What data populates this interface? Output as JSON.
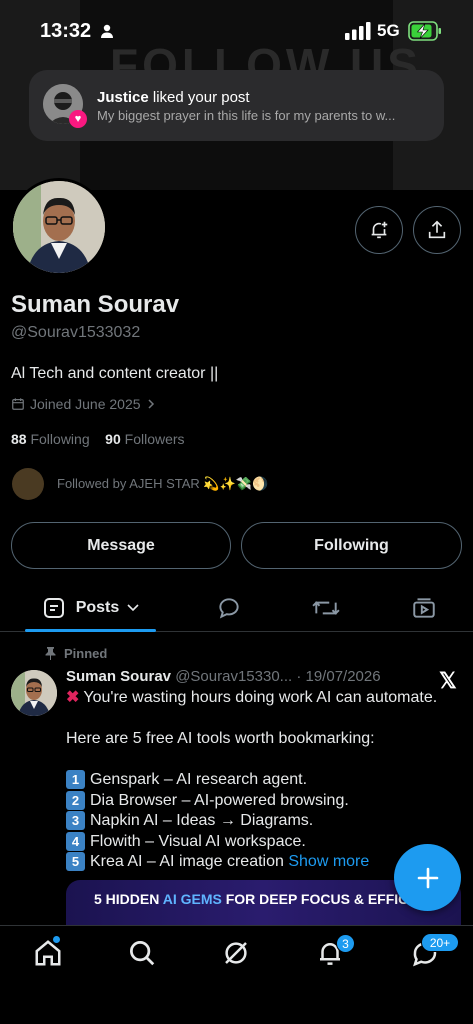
{
  "status_bar": {
    "time": "13:32",
    "network": "5G"
  },
  "banner": {
    "text": "FOLLOW US"
  },
  "notification": {
    "user": "Justice",
    "action": " liked your post",
    "body": "My biggest prayer in this life is for my parents to w..."
  },
  "profile": {
    "name": "Suman Sourav",
    "handle": "@Sourav1533032",
    "bio": "Al Tech and content creator ||",
    "joined": "Joined June 2025",
    "following_count": "88",
    "following_label": "Following",
    "followers_count": "90",
    "followers_label": "Followers",
    "followed_by": "Followed by AJEH STAR 💫✨💸🌖"
  },
  "actions": {
    "message": "Message",
    "following": "Following"
  },
  "tabs": {
    "posts": "Posts"
  },
  "post": {
    "pinned": "Pinned",
    "author": "Suman Sourav",
    "meta": " @Sourav15330... · 19/07/2026",
    "line1": "You're wasting hours doing work AI can automate.",
    "line2": "Here are 5 free AI tools worth bookmarking:",
    "items": [
      {
        "n": "1",
        "text": "Genspark – AI research agent."
      },
      {
        "n": "2",
        "text": "Dia Browser – AI-powered browsing."
      },
      {
        "n": "3",
        "text": "Napkin AI – Ideas → Diagrams."
      },
      {
        "n": "4",
        "text": "Flowith – Visual AI workspace."
      },
      {
        "n": "5",
        "text": "Krea AI – AI image creation "
      }
    ],
    "show_more": "Show more",
    "media_pre": "5 HIDDEN ",
    "media_hl": "AI GEMS",
    "media_post": " FOR DEEP FOCUS & EFFICIE"
  },
  "nav": {
    "notifications_badge": "3",
    "messages_badge": "20+"
  },
  "colors": {
    "accent": "#1d9bf0",
    "like": "#f91880"
  }
}
